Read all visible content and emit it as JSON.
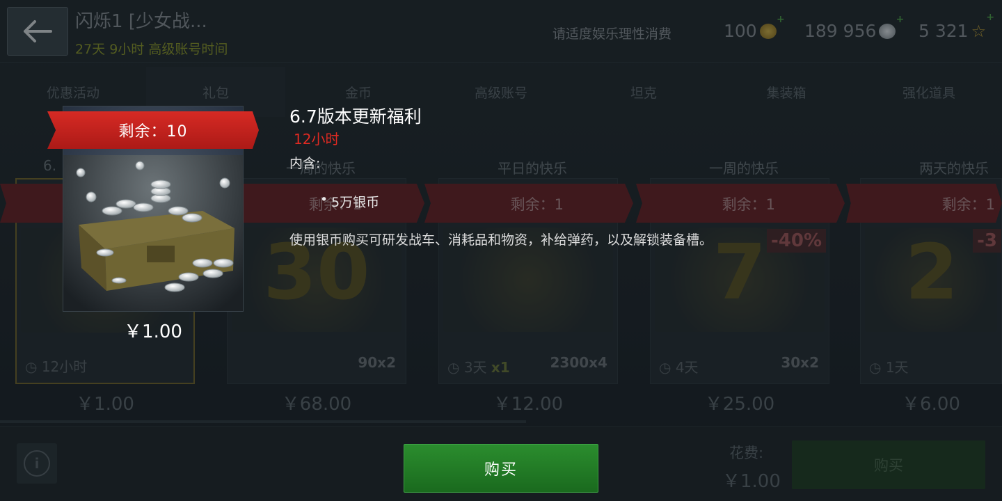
{
  "header": {
    "account_name": "闪烁1 [少女战...",
    "premium_time": "27天 9小时 高级账号时间",
    "notice": "请适度娱乐理性消费",
    "currencies": [
      {
        "value": "100",
        "icon": "gold-coin-icon"
      },
      {
        "value": "189 956",
        "icon": "silver-coin-icon"
      },
      {
        "value": "5 321",
        "icon": "star-icon"
      }
    ]
  },
  "tabs": [
    "优惠活动",
    "礼包",
    "金币",
    "高级账号",
    "坦克",
    "集装箱",
    "强化道具"
  ],
  "active_tab": "礼包",
  "cards": [
    {
      "title": "6.",
      "remaining": "",
      "duration": "12小时",
      "extra": "",
      "price": "￥1.00"
    },
    {
      "title": "一周的快乐",
      "remaining": "剩余：1",
      "duration": "",
      "extra": "90x2",
      "price": "￥68.00"
    },
    {
      "title": "平日的快乐",
      "remaining": "剩余：1",
      "duration": "3天",
      "extra": "2300x4",
      "price": "￥12.00",
      "extra_mult": "x1"
    },
    {
      "title": "一周的快乐",
      "remaining": "剩余：1",
      "duration": "4天",
      "extra": "30x2",
      "price": "￥25.00",
      "discount": "-40%",
      "big_number": "7"
    },
    {
      "title": "两天的快乐",
      "remaining": "剩余：1",
      "duration": "1天",
      "extra": "",
      "price": "￥6.00",
      "discount": "-3",
      "big_number": "2"
    }
  ],
  "card1_big_number": "30",
  "popup": {
    "remaining_label": "剩余：10",
    "price": "￥1.00",
    "title": "6.7版本更新福利",
    "timer": "12小时",
    "contains_label": "内含:",
    "items": [
      "5万银币"
    ],
    "description": "使用银币购买可研发战车、消耗品和物资，补给弹药，以及解锁装备槽。"
  },
  "footer": {
    "cost_label": "花费:",
    "cost_value": "￥1.00",
    "buy_label": "购买",
    "buy_main_label": "购买",
    "info_symbol": "i"
  },
  "colors": {
    "accent_red": "#d62a24",
    "timer_red": "#e02a22",
    "buy_green": "#2b8d2e",
    "premium_yellow": "#8f9b2a"
  }
}
